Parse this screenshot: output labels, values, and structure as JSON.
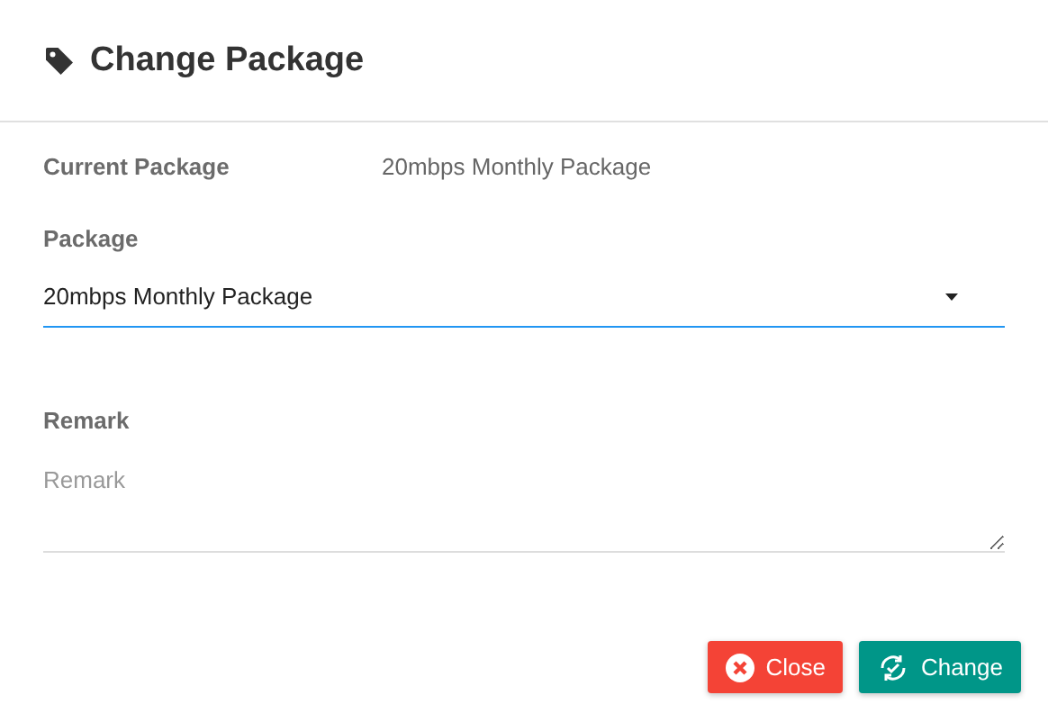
{
  "dialog": {
    "title": "Change Package"
  },
  "current_package": {
    "label": "Current Package",
    "value": "20mbps Monthly Package"
  },
  "package": {
    "label": "Package",
    "value": "20mbps Monthly Package",
    "focused": true
  },
  "remark": {
    "label": "Remark",
    "placeholder": "Remark"
  },
  "buttons": [
    {
      "kind": "close",
      "label": "Close"
    },
    {
      "kind": "change",
      "label": "Change"
    }
  ]
}
